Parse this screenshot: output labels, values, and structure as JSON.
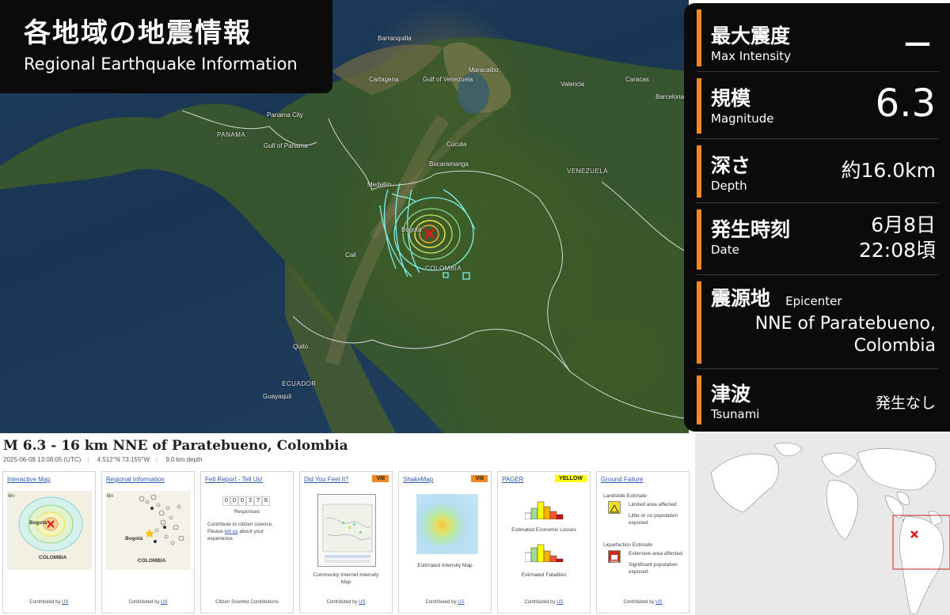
{
  "header": {
    "title_jp": "各地域の地震情報",
    "title_en": "Regional Earthquake Information"
  },
  "info_panel": {
    "max_intensity": {
      "label_jp": "最大震度",
      "label_en": "Max  Intensity",
      "value": "—"
    },
    "magnitude": {
      "label_jp": "規模",
      "label_en": "Magnitude",
      "value": "6.3"
    },
    "depth": {
      "label_jp": "深さ",
      "label_en": "Depth",
      "value": "約16.0km"
    },
    "date": {
      "label_jp": "発生時刻",
      "label_en": "Date",
      "value_line1": "6月8日",
      "value_line2": "22:08頃"
    },
    "epicenter": {
      "label_jp": "震源地",
      "label_en": "Epicenter",
      "value_line1": "NNE of Paratebueno,",
      "value_line2": "Colombia"
    },
    "tsunami": {
      "label_jp": "津波",
      "label_en": "Tsunami",
      "value": "発生なし"
    }
  },
  "map_labels": {
    "cities": [
      "Barranquilla",
      "Maracaibo",
      "Cartagena",
      "Caracas",
      "Valencia",
      "Barcelona",
      "Cúcuta",
      "Bucaramanga",
      "Medellín",
      "Panama City",
      "Bogotá",
      "Cali",
      "Quito",
      "Guayaquil",
      "Gulf of Panama",
      "Gulf of Venezuela"
    ],
    "countries": [
      "PANAMA",
      "VENEZUELA",
      "COLOMBIA",
      "ECUADOR"
    ]
  },
  "event": {
    "title": "M 6.3 - 16 km NNE of Paratebueno, Colombia",
    "datetime": "2025-06-08 13:08:05 (UTC)",
    "coords": "4.512°N 73.155°W",
    "depth": "9.0 km depth"
  },
  "cards": [
    {
      "title": "Interactive Map",
      "footer": "Contributed by",
      "footer_link": "US",
      "map_labels": [
        "llin",
        "Bogotá",
        "COLOMBIA"
      ]
    },
    {
      "title": "Regional Information",
      "footer": "Contributed by",
      "footer_link": "US",
      "map_labels": [
        "llin",
        "Bogotá",
        "COLOMBIA"
      ]
    },
    {
      "title": "Felt Report - Tell Us!",
      "counter": [
        "0",
        "0",
        "0",
        "3",
        "7",
        "6"
      ],
      "counter_label": "Responses",
      "text1": "Contribute to citizen science.",
      "text2_pre": "Please ",
      "text2_link": "tell us",
      "text2_post": " about your",
      "text3": "experience.",
      "footer": "Citizen Scientist Contributions"
    },
    {
      "title": "Did You Feel It?",
      "badge": "VIII",
      "caption_line1": "Community Internet Intensity",
      "caption_line2": "Map",
      "footer": "Contributed by",
      "footer_link": "US"
    },
    {
      "title": "ShakeMap",
      "badge": "VIII",
      "caption": "Estimated Intensity Map",
      "footer": "Contributed by",
      "footer_link": "US"
    },
    {
      "title": "PAGER",
      "badge": "YELLOW",
      "caption1": "Estimated Economic Losses",
      "caption2": "Estimated Fatalities",
      "footer": "Contributed by",
      "footer_link": "US"
    },
    {
      "title": "Ground Failure",
      "landslide_title": "Landslide Estimate",
      "landslide_l1": "Limited area affected",
      "landslide_l2": "Little or no population",
      "landslide_l3": "exposed",
      "liq_title": "Liquefaction Estimate",
      "liq_l1": "Extensive area affected",
      "liq_l2": "Significant population",
      "liq_l3": "exposed",
      "footer": "Contributed by",
      "footer_link": "US"
    }
  ],
  "colors": {
    "accent": "#f08a24",
    "panel": "#0b0b0b",
    "link": "#2f5bb5",
    "badge_orange": "#f08a24",
    "badge_yellow": "#ffff00"
  }
}
